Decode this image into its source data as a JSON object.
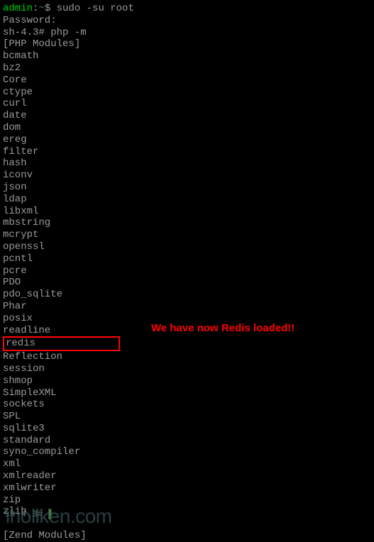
{
  "prompt": {
    "user": "admin",
    "sep": ":",
    "tilde": "~",
    "dollar": "$",
    "command": " sudo -su root"
  },
  "lines_before": [
    "Password:",
    "sh-4.3# php -m",
    "[PHP Modules]"
  ],
  "modules": [
    "bcmath",
    "bz2",
    "Core",
    "ctype",
    "curl",
    "date",
    "dom",
    "ereg",
    "filter",
    "hash",
    "iconv",
    "json",
    "ldap",
    "libxml",
    "mbstring",
    "mcrypt",
    "openssl",
    "pcntl",
    "pcre",
    "PDO",
    "pdo_sqlite",
    "Phar",
    "posix",
    "readline"
  ],
  "highlighted_module": "redis",
  "modules_after": [
    "Reflection",
    "session",
    "shmop",
    "SimpleXML",
    "sockets",
    "SPL",
    "sqlite3",
    "standard",
    "syno_compiler",
    "xml",
    "xmlreader",
    "xmlwriter",
    "zip",
    "zlib"
  ],
  "lines_after": [
    "",
    "[Zend Modules]"
  ],
  "annotation": "We have now Redis loaded!!",
  "watermark": "ihollken.com",
  "bottom_prompt": "sh-4.3# "
}
